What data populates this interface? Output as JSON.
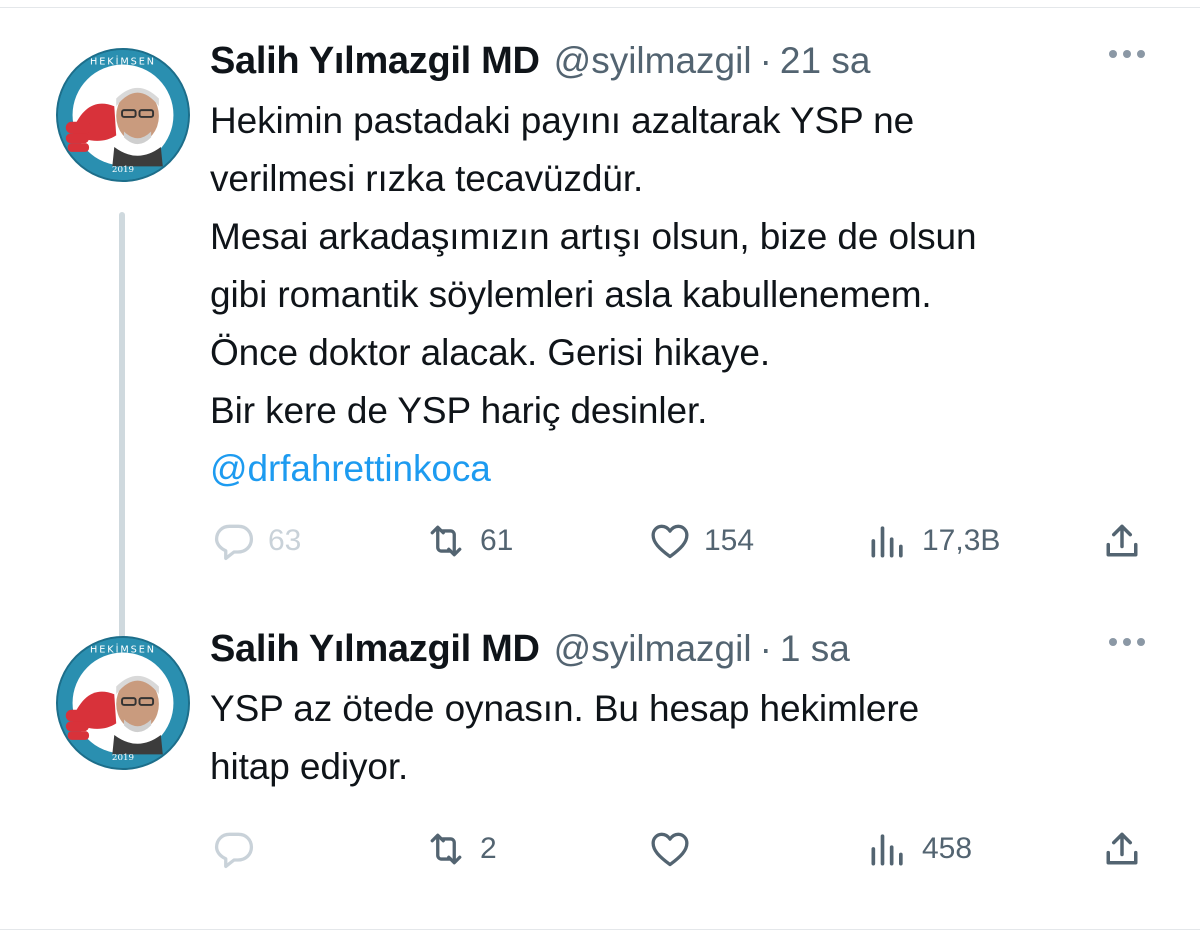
{
  "tweets": [
    {
      "author_name": "Salih Yılmazgil MD",
      "handle": "@syilmazgil",
      "separator": "·",
      "time": "21 sa",
      "text_lines": [
        "Hekimin pastadaki payını azaltarak YSP ne",
        "verilmesi rızka tecavüzdür.",
        "Mesai arkadaşımızın artışı olsun, bize de olsun",
        "gibi romantik söylemleri asla kabullenemem.",
        "Önce doktor alacak. Gerisi hikaye.",
        "Bir kere de YSP hariç desinler."
      ],
      "mention": "@drfahrettinkoca",
      "stats": {
        "replies": "63",
        "retweets": "61",
        "likes": "154",
        "views": "17,3B"
      },
      "avatar": {
        "ring_text": "HEKİMSEN",
        "year": "2019"
      }
    },
    {
      "author_name": "Salih Yılmazgil MD",
      "handle": "@syilmazgil",
      "separator": "·",
      "time": "1 sa",
      "text_lines": [
        "YSP az ötede oynasın. Bu hesap hekimlere",
        "hitap ediyor."
      ],
      "stats": {
        "replies": "",
        "retweets": "2",
        "likes": "",
        "views": "458"
      },
      "avatar": {
        "ring_text": "HEKİMSEN",
        "year": "2019"
      }
    }
  ],
  "icons": [
    "reply-icon",
    "retweet-icon",
    "like-icon",
    "views-icon",
    "share-icon",
    "more-icon"
  ],
  "colors": {
    "text": "#0f1419",
    "secondary": "#536471",
    "mention": "#1d9bf0",
    "thread_line": "#cfd9de",
    "avatar_bg": "#2a8fb0",
    "avatar_hand": "#d8323a"
  }
}
